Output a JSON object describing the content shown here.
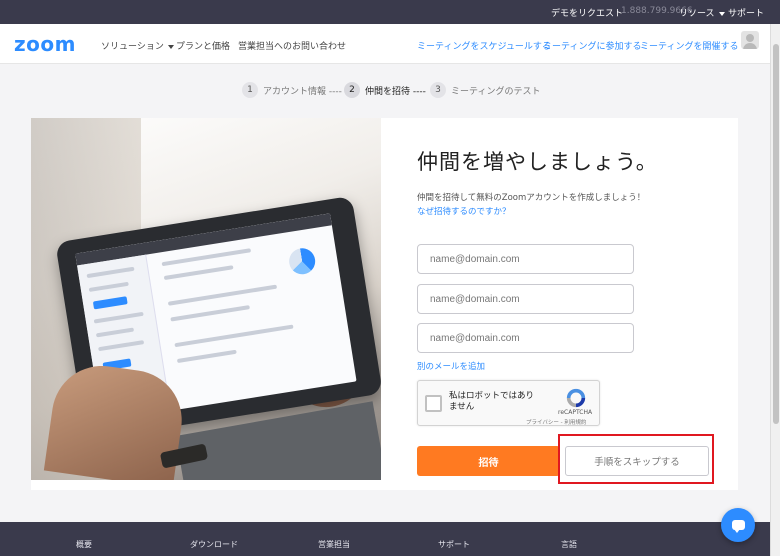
{
  "topbar": {
    "demo_request": "デモをリクエスト",
    "phone": "1.888.799.9666",
    "resources": "リソース",
    "support": "サポート"
  },
  "navbar": {
    "logo": "zoom",
    "solutions": "ソリューション",
    "plans_pricing": "プランと価格",
    "contact_sales": "営業担当へのお問い合わせ",
    "schedule_meeting": "ミーティングをスケジュールする",
    "join_meeting": "ミーティングに参加する",
    "host_meeting": "ミーティングを開催する"
  },
  "steps": [
    {
      "num": "1",
      "label": "アカウント情報 ----"
    },
    {
      "num": "2",
      "label": "仲間を招待 ----"
    },
    {
      "num": "3",
      "label": "ミーティングのテスト"
    }
  ],
  "main": {
    "title": "仲間を増やしましょう。",
    "subtitle": "仲間を招待して無料のZoomアカウントを作成しましょう！",
    "why_link": "なぜ招待するのですか？",
    "email_placeholder": "name@domain.com",
    "add_email_link": "別のメールを追加",
    "captcha_label": "私はロボットではありません",
    "captcha_brand": "reCAPTCHA",
    "captcha_terms": "プライバシー - 利用規約",
    "invite_button": "招待",
    "skip_button": "手順をスキップする"
  },
  "footer": {
    "about": "概要",
    "download": "ダウンロード",
    "sales": "営業担当",
    "support": "サポート",
    "language": "言語"
  },
  "colors": {
    "brand_blue": "#2d8cff",
    "invite_orange": "#ff7a21",
    "highlight_red": "#e01820",
    "dark_bar": "#3a3a4c"
  }
}
